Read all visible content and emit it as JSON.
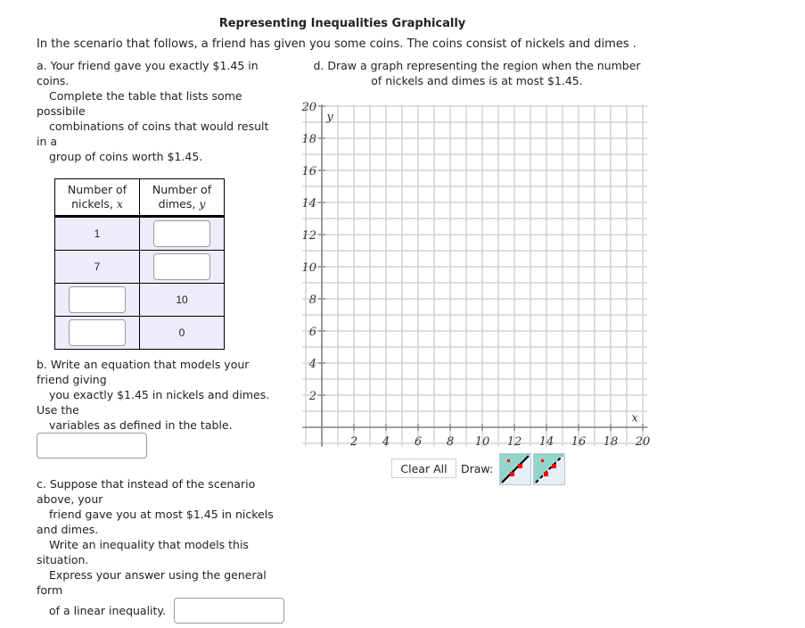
{
  "title": "Representing Inequalities Graphically",
  "intro": "In the scenario that follows, a friend has given you some coins. The coins consist of nickels and dimes .",
  "part_a": {
    "lines": [
      {
        "text": "a. Your friend gave you exactly $1.45 in",
        "indent": false
      },
      {
        "text": "coins.",
        "indent": false
      },
      {
        "text": "Complete the table that lists some",
        "indent": true
      },
      {
        "text": "possibile",
        "indent": false
      },
      {
        "text": "combinations of coins that would result",
        "indent": true
      },
      {
        "text": "in a",
        "indent": false
      },
      {
        "text": "group of coins worth $1.45.",
        "indent": true
      }
    ],
    "table": {
      "headers": [
        {
          "line1": "Number of",
          "line2": "nickels,",
          "var": "x"
        },
        {
          "line1": "Number of",
          "line2": "dimes,",
          "var": "y"
        }
      ],
      "rows": [
        {
          "nickels": "1",
          "dimes": null
        },
        {
          "nickels": "7",
          "dimes": null
        },
        {
          "nickels": null,
          "dimes": "10"
        },
        {
          "nickels": null,
          "dimes": "0"
        }
      ]
    }
  },
  "part_b": {
    "lines": [
      {
        "text": "b. Write an equation that models your",
        "indent": false
      },
      {
        "text": "friend giving",
        "indent": false
      },
      {
        "text": "you exactly $1.45 in nickels and dimes.",
        "indent": true
      },
      {
        "text": "Use the",
        "indent": false
      },
      {
        "text": "variables as defined in the table.",
        "indent": true
      }
    ],
    "answer_value": ""
  },
  "part_c": {
    "lines": [
      {
        "text": "c. Suppose that instead of the scenario",
        "indent": false
      },
      {
        "text": "above, your",
        "indent": false
      },
      {
        "text": "friend gave you at most $1.45 in nickels",
        "indent": true
      },
      {
        "text": "and dimes.",
        "indent": false
      },
      {
        "text": "Write an inequality that models this",
        "indent": true
      },
      {
        "text": "situation.",
        "indent": false
      },
      {
        "text": "Express your answer using the general",
        "indent": true
      },
      {
        "text": "form",
        "indent": false
      }
    ],
    "last_line": "of a linear inequality.",
    "answer_value": ""
  },
  "part_d": {
    "line1": "d. Draw a graph representing the region when the number",
    "line2": "of nickels and dimes is at most $1.45."
  },
  "graph": {
    "x_axis_label": "x",
    "y_axis_label": "y",
    "x_range": [
      -1.2,
      20.3
    ],
    "y_range": [
      -1.2,
      20.1
    ],
    "grid_step": 1,
    "x_ticks": [
      "2",
      "4",
      "6",
      "8",
      "10",
      "12",
      "14",
      "16",
      "18",
      "20"
    ],
    "y_ticks": [
      "2",
      "4",
      "6",
      "8",
      "10",
      "12",
      "14",
      "16",
      "18",
      "20"
    ],
    "colors": {
      "grid": "#d4d4d4",
      "axis": "#808080",
      "label": "#333333"
    }
  },
  "controls": {
    "clear_all": "Clear All",
    "draw_label": "Draw:",
    "tools": [
      {
        "name": "solid-line-region-tool",
        "line_style": "solid"
      },
      {
        "name": "dashed-line-region-tool",
        "line_style": "dashed"
      }
    ],
    "colors": {
      "region": "#93d4cb",
      "bg": "#e6eef6",
      "point": "#ff0000",
      "line": "#000000"
    }
  }
}
